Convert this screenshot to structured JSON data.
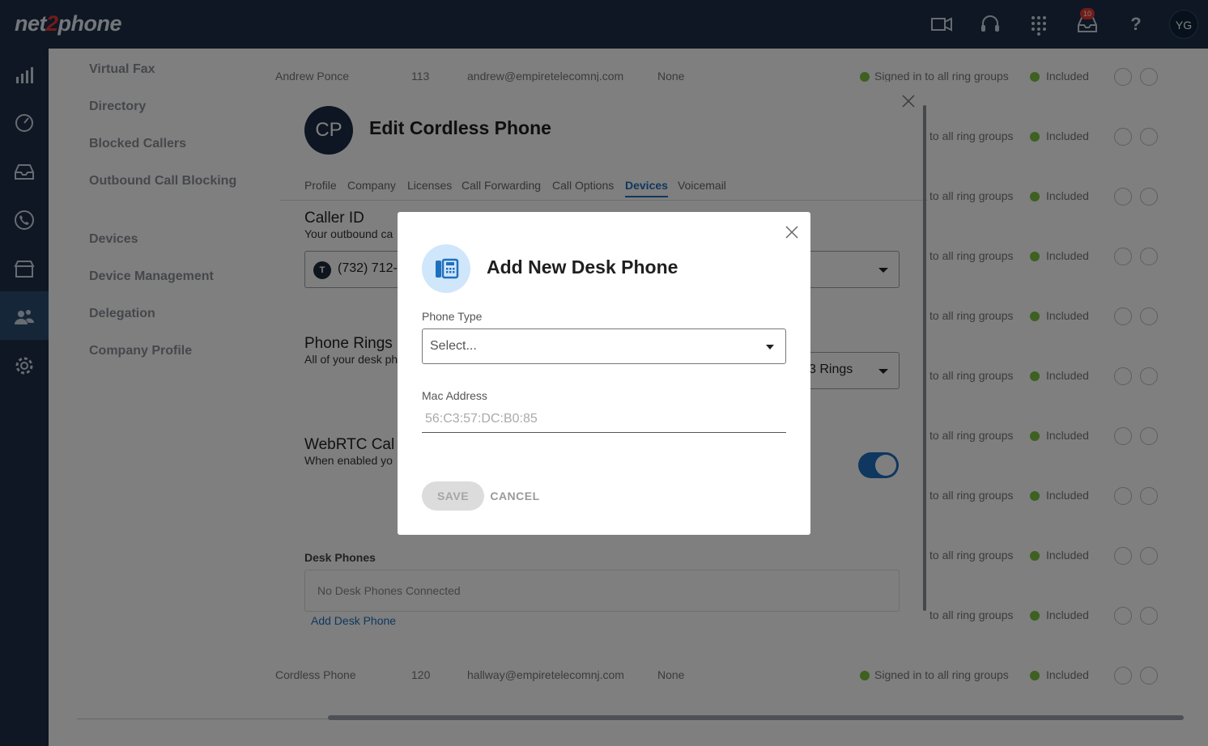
{
  "app": {
    "logo_left": "net",
    "logo_mid": "2",
    "logo_right": "phone",
    "notification_count": "10",
    "user_initials": "YG"
  },
  "subnav": {
    "items": [
      "Virtual Fax",
      "Directory",
      "Blocked Callers",
      "Outbound Call Blocking",
      "Devices",
      "Device Management",
      "Delegation",
      "Company Profile"
    ]
  },
  "bg_table": {
    "first_row": {
      "name": "Andrew Ponce",
      "ext": "113",
      "email": "andrew@empiretelecomnj.com",
      "col4": "None",
      "status": "Signed in to all ring groups",
      "included": "Included"
    },
    "last_row": {
      "name": "Cordless Phone",
      "ext": "120",
      "email": "hallway@empiretelecomnj.com",
      "col4": "None",
      "status": "Signed in to all ring groups",
      "included": "Included"
    },
    "status_fragment": "to all ring groups",
    "included": "Included"
  },
  "edit_modal": {
    "avatar_initials": "CP",
    "title": "Edit Cordless Phone",
    "tabs": [
      "Profile",
      "Company",
      "Licenses",
      "Call Forwarding",
      "Call Options",
      "Devices",
      "Voicemail"
    ],
    "active_tab": "Devices",
    "caller_id": {
      "title": "Caller ID",
      "subtitle": "Your outbound ca",
      "badge": "T",
      "value": "(732) 712-"
    },
    "phone_rings": {
      "title": "Phone Rings",
      "subtitle": "All of your desk ph",
      "value": "3 Rings"
    },
    "webrtc": {
      "title": "WebRTC Cal",
      "subtitle": "When enabled yo",
      "enabled": true
    },
    "desk_phones": {
      "title": "Desk Phones",
      "empty_text": "No Desk Phones Connected",
      "add_link": "Add Desk Phone"
    }
  },
  "add_modal": {
    "title": "Add New Desk Phone",
    "icon": "desk-phone-icon",
    "phone_type": {
      "label": "Phone Type",
      "value": "Select..."
    },
    "mac_address": {
      "label": "Mac Address",
      "placeholder": "56:C3:57:DC:B0:85"
    },
    "save_label": "SAVE",
    "cancel_label": "CANCEL"
  },
  "colors": {
    "nav_bg": "#1c2f47",
    "accent": "#1f6fbf",
    "icon_circle": "#cfe6fb",
    "status_green": "#7cc043"
  }
}
